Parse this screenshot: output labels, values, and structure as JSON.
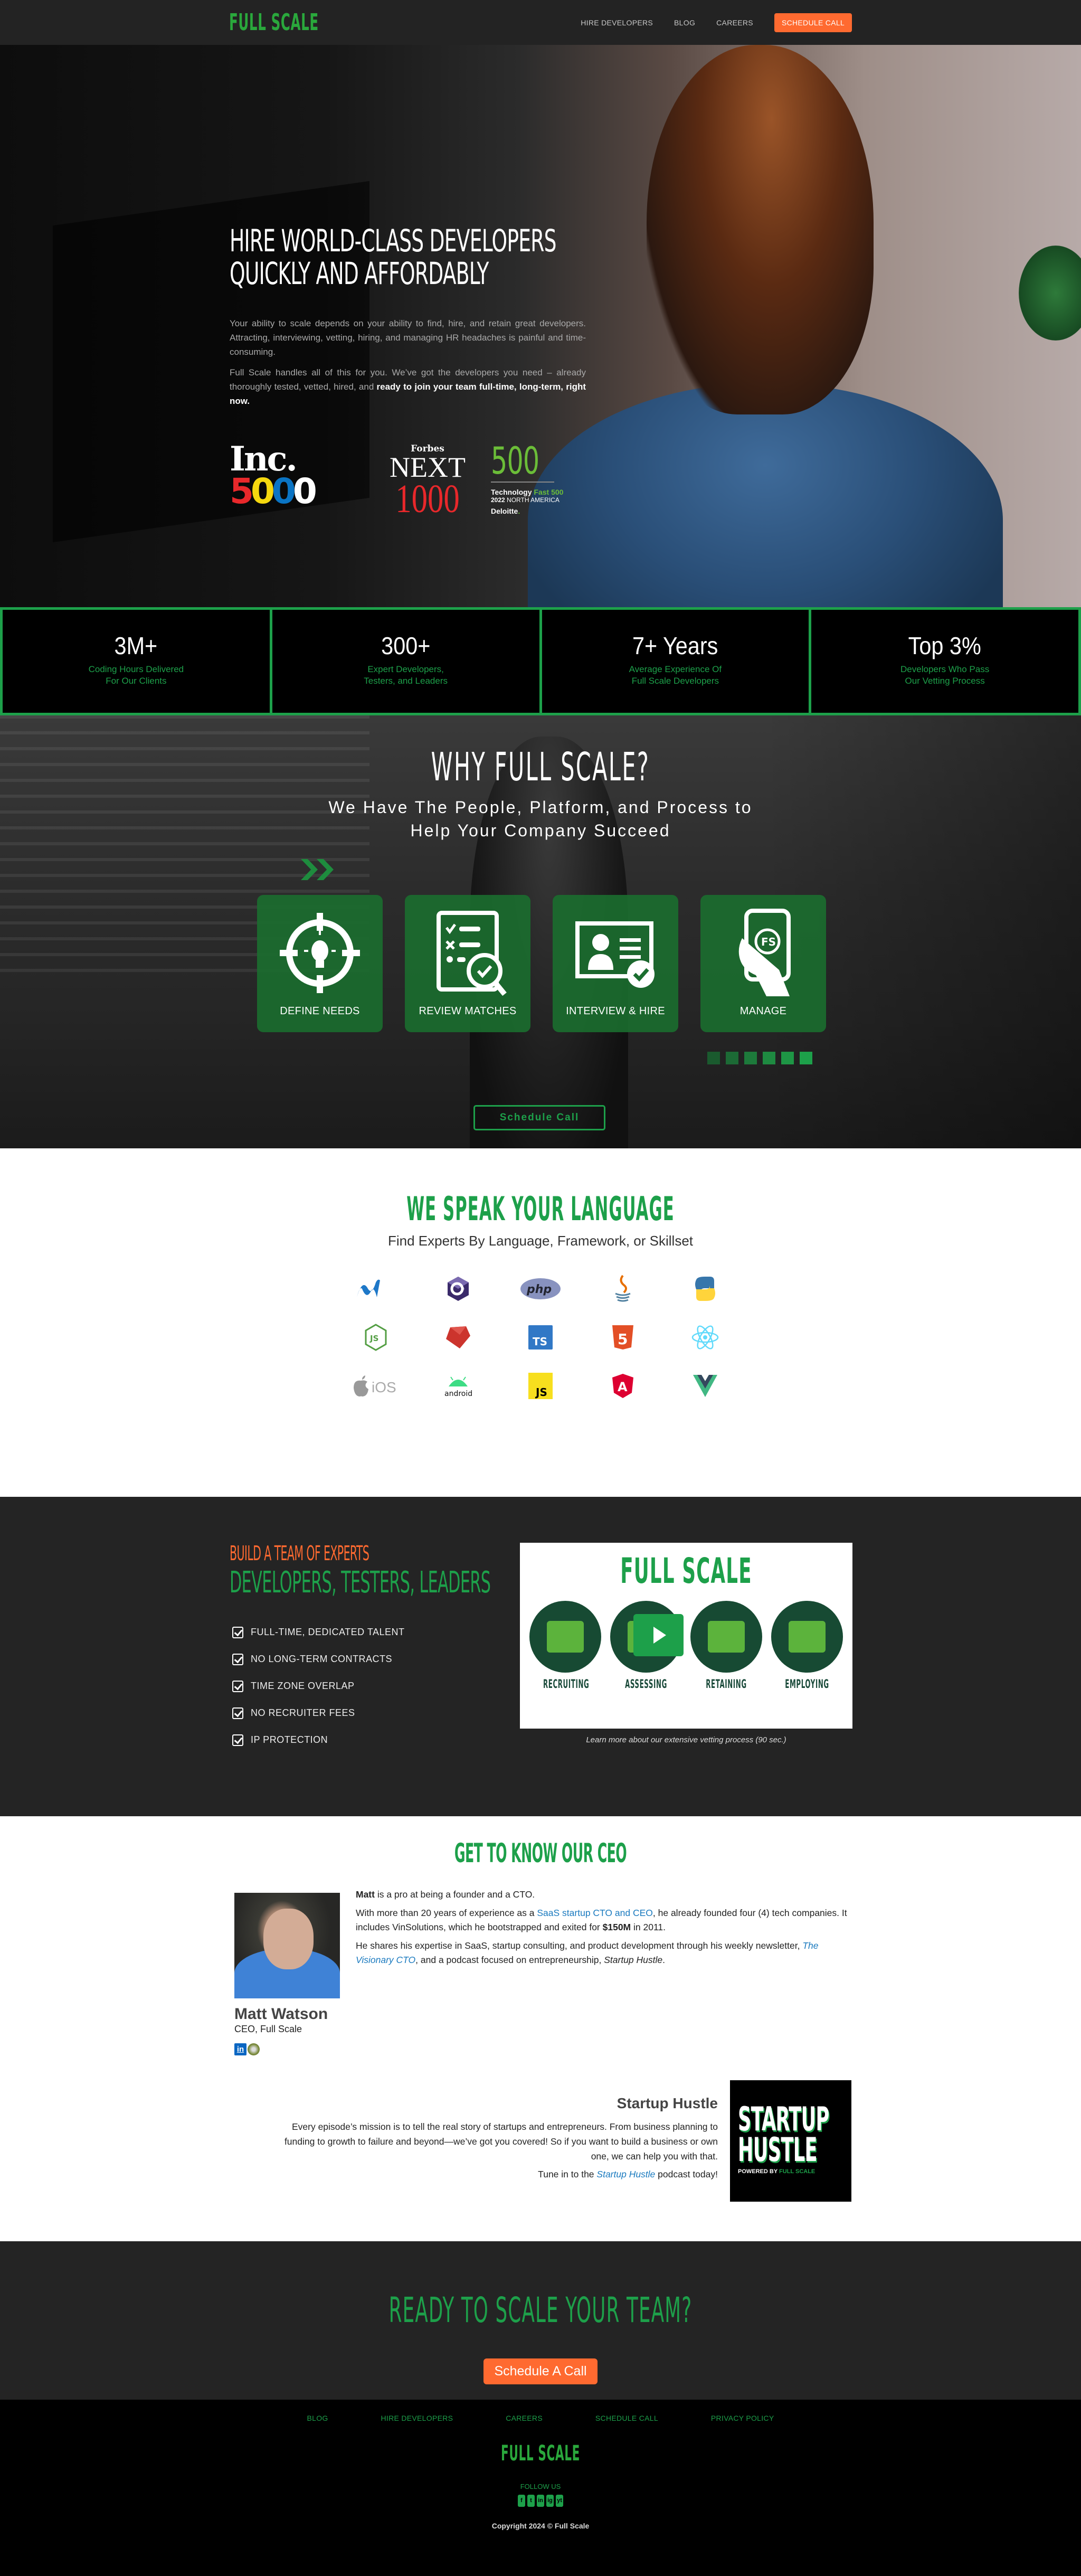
{
  "nav": {
    "logo": "FULL SCALE",
    "links": [
      "HIRE DEVELOPERS",
      "BLOG",
      "CAREERS"
    ],
    "cta": "SCHEDULE CALL"
  },
  "hero": {
    "title_line1": "HIRE WORLD-CLASS DEVELOPERS",
    "title_line2": "QUICKLY AND AFFORDABLY",
    "para1": "Your ability to scale depends on your ability to find, hire, and retain great developers. Attracting, interviewing, vetting, hiring, and managing HR headaches is painful and time-consuming.",
    "para2_plain": "Full Scale handles all of this for you. We’ve got the developers you need – already thoroughly tested, vetted, hired, and ",
    "para2_bold": "ready to join your team full-time, long-term, right now.",
    "awards": {
      "inc_top": "Inc.",
      "inc_digits": [
        "5",
        "0",
        "0",
        "0"
      ],
      "forbes_brand": "Forbes",
      "forbes_next": "NEXT",
      "forbes_num": "1000",
      "deloitte_num": "500",
      "deloitte_l1a": "Technology ",
      "deloitte_l1b": "Fast 500",
      "deloitte_year": "2022",
      "deloitte_region": " NORTH AMERICA",
      "deloitte_brand": "Deloitte",
      "deloitte_dot": "."
    }
  },
  "stats": [
    {
      "value": "3M+",
      "desc": "Coding Hours Delivered For Our Clients"
    },
    {
      "value": "300+",
      "desc": "Expert Developers, Testers, and Leaders"
    },
    {
      "value": "7+ Years",
      "desc": "Average Experience Of Full Scale Developers"
    },
    {
      "value": "Top 3%",
      "desc": "Developers Who Pass Our Vetting Process"
    }
  ],
  "why": {
    "title": "WHY FULL SCALE?",
    "subtitle_l1": "We Have The People, Platform, and Process to",
    "subtitle_l2": "Help Your Company Succeed",
    "cards": [
      {
        "label": "DEFINE NEEDS",
        "icon": "lightbulb-target-icon"
      },
      {
        "label": "REVIEW MATCHES",
        "icon": "checklist-magnifier-icon"
      },
      {
        "label": "INTERVIEW & HIRE",
        "icon": "profile-check-icon"
      },
      {
        "label": "MANAGE",
        "icon": "phone-in-hand-icon"
      }
    ],
    "dot_colors": [
      "#1a5a2e",
      "#1c6a35",
      "#1d7a3b",
      "#1e8a41",
      "#1e9645",
      "#1da04a"
    ],
    "schedule_label": "Schedule Call"
  },
  "language": {
    "title": "WE SPEAK YOUR LANGUAGE",
    "subtitle": "Find Experts By Language, Framework, or Skillset",
    "techs": [
      ".NET",
      "C#",
      "PHP",
      "Java",
      "Python",
      "Node.js",
      "Ruby",
      "TypeScript",
      "HTML5",
      "React",
      "iOS",
      "Android",
      "JavaScript",
      "Angular",
      "Vue"
    ],
    "labels": {
      "php": "php",
      "ts": "TS",
      "js": "JS",
      "ios": "iOS",
      "android": "android",
      "html": "5",
      "angular": "A",
      "node": "JS",
      "csharp": "C#"
    }
  },
  "team": {
    "kicker": "BUILD A TEAM OF EXPERTS",
    "headline": "DEVELOPERS, TESTERS, LEADERS",
    "benefits": [
      "FULL-TIME, DEDICATED TALENT",
      "NO LONG-TERM CONTRACTS",
      "TIME ZONE OVERLAP",
      "NO RECRUITER FEES",
      "IP PROTECTION"
    ],
    "video": {
      "title": "FULL SCALE",
      "steps": [
        "RECRUITING",
        "ASSESSING",
        "RETAINING",
        "EMPLOYING"
      ],
      "caption": "Learn more about our extensive vetting process (90 sec.)"
    }
  },
  "ceo": {
    "title": "GET TO KNOW OUR CEO",
    "name": "Matt Watson",
    "role": "CEO, Full Scale",
    "linkedin": "in",
    "bio": {
      "p1_bold": "Matt",
      "p1_rest": " is a pro at being a founder and a CTO.",
      "p2_a": "With more than 20 years of experience as a ",
      "p2_link": "SaaS startup CTO and CEO",
      "p2_b": ", he already founded four (4) tech companies. It includes VinSolutions, which he bootstrapped and exited for ",
      "p2_bold": "$150M",
      "p2_c": " in 2011.",
      "p3_a": "He shares his expertise in SaaS, startup consulting, and product development through his weekly newsletter, ",
      "p3_link": "The Visionary CTO",
      "p3_b": ", and a podcast focused on entrepreneurship, ",
      "p3_ital": "Startup Hustle",
      "p3_c": "."
    },
    "podcast": {
      "title": "Startup Hustle",
      "body": "Every episode’s mission is to tell the real story of startups and entrepreneurs. From business planning to funding to growth to failure and beyond—we’ve got you covered! So if you want to build a business or own one, we can help you with that.",
      "tune_a": "Tune in to the ",
      "tune_link": "Startup Hustle",
      "tune_b": " podcast today!",
      "cover_l1": "STARTUP",
      "cover_l2": "HUSTLE",
      "cover_powered": "POWERED BY ",
      "cover_brand": "FULL SCALE"
    }
  },
  "cta": {
    "title": "READY TO SCALE YOUR TEAM?",
    "button": "Schedule A Call"
  },
  "footer": {
    "links": [
      "BLOG",
      "HIRE DEVELOPERS",
      "CAREERS",
      "SCHEDULE CALL",
      "PRIVACY POLICY"
    ],
    "logo": "FULL SCALE",
    "follow": "FOLLOW US",
    "social": [
      "f",
      "t",
      "in",
      "ig",
      "yt"
    ],
    "copyright": "Copyright 2024 © Full Scale"
  },
  "colors": {
    "brand_green": "#1da04a",
    "accent_orange": "#ff6a30",
    "dark": "#242424"
  }
}
